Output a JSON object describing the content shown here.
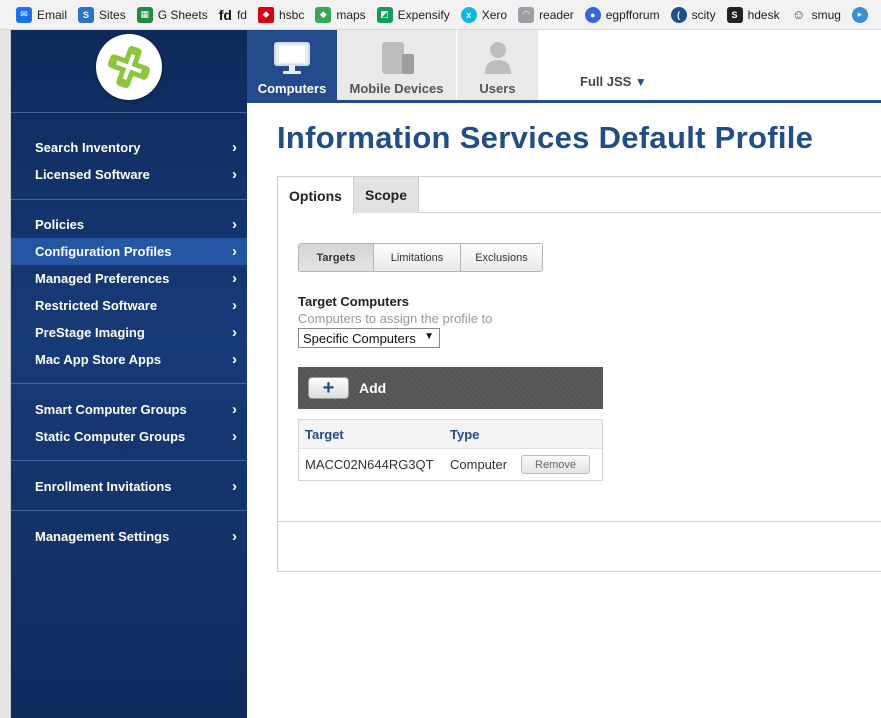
{
  "bookmarks": [
    {
      "label": "Email",
      "icon": "mail-icon",
      "color": "#1a73e8"
    },
    {
      "label": "Sites",
      "icon": "sharepoint-icon",
      "color": "#2a73c9"
    },
    {
      "label": "G Sheets",
      "icon": "sheets-icon",
      "color": "#1e8e3e"
    },
    {
      "label": "fd",
      "icon": "fd-icon",
      "color": "#111111"
    },
    {
      "label": "hsbc",
      "icon": "hsbc-icon",
      "color": "#db0011"
    },
    {
      "label": "maps",
      "icon": "maps-icon",
      "color": "#34a853"
    },
    {
      "label": "Expensify",
      "icon": "expensify-icon",
      "color": "#0f9d58"
    },
    {
      "label": "Xero",
      "icon": "xero-icon",
      "color": "#13b5ea"
    },
    {
      "label": "reader",
      "icon": "rss-icon",
      "color": "#9aa0a6"
    },
    {
      "label": "egpfforum",
      "icon": "forum-icon",
      "color": "#3367d6"
    },
    {
      "label": "scity",
      "icon": "scity-icon",
      "color": "#1f4e8c"
    },
    {
      "label": "hdesk",
      "icon": "hdesk-icon",
      "color": "#222222"
    },
    {
      "label": "smug",
      "icon": "smug-icon",
      "color": "#444444"
    }
  ],
  "sidebar": {
    "groups": [
      [
        "Search Inventory",
        "Licensed Software"
      ],
      [
        "Policies",
        "Configuration Profiles",
        "Managed Preferences",
        "Restricted Software",
        "PreStage Imaging",
        "Mac App Store Apps"
      ],
      [
        "Smart Computer Groups",
        "Static Computer Groups"
      ],
      [
        "Enrollment Invitations"
      ],
      [
        "Management Settings"
      ]
    ],
    "active": "Configuration Profiles"
  },
  "topnav": {
    "tabs": [
      "Computers",
      "Mobile Devices",
      "Users"
    ],
    "active": "Computers",
    "context": "Full JSS"
  },
  "page": {
    "title": "Information Services Default Profile",
    "tabs": [
      "Options",
      "Scope"
    ],
    "active_tab": "Options",
    "segments": [
      "Targets",
      "Limitations",
      "Exclusions"
    ],
    "active_segment": "Targets",
    "target_label": "Target Computers",
    "target_help": "Computers to assign the profile to",
    "target_select": "Specific Computers",
    "add_label": "Add",
    "table": {
      "headers": [
        "Target",
        "Type"
      ],
      "rows": [
        {
          "target": "MACC02N644RG3QT",
          "type": "Computer",
          "action": "Remove"
        }
      ]
    }
  },
  "colors": {
    "brand_blue": "#234d86",
    "sidebar": "#173a78",
    "active_item": "#2456a3"
  }
}
